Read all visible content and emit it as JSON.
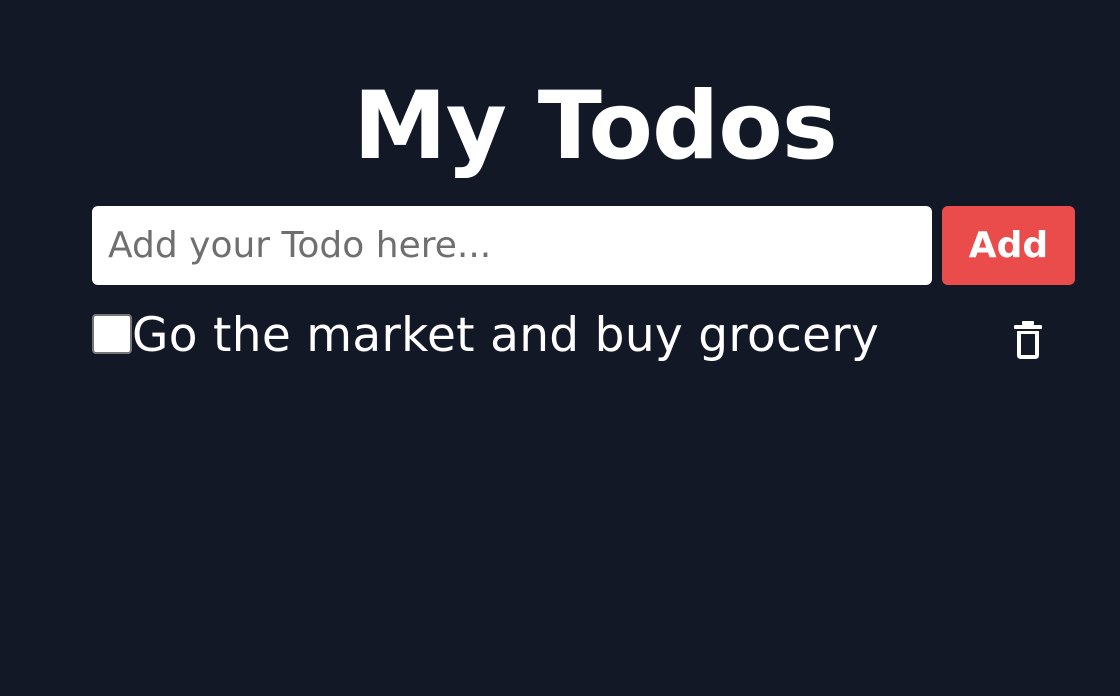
{
  "header": {
    "title": "My Todos"
  },
  "form": {
    "input_value": "",
    "input_placeholder": "Add your Todo here...",
    "add_label": "Add"
  },
  "todos": [
    {
      "text": "Go the market and buy grocery",
      "completed": false,
      "delete_icon": "trash-icon"
    }
  ],
  "colors": {
    "background": "#131826",
    "accent": "#ea4c4c",
    "text": "#ffffff"
  }
}
